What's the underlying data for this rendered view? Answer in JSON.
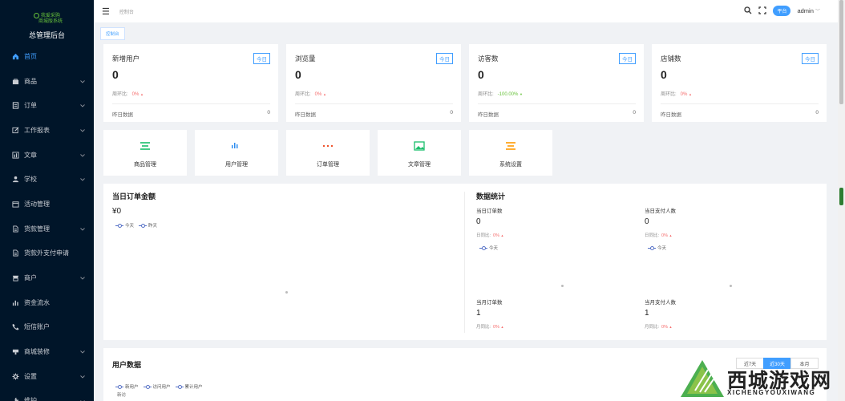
{
  "app": {
    "logo_line1": "我爱采购",
    "logo_line2": "商城版系统",
    "title": "总管理后台"
  },
  "sidebar": {
    "items": [
      {
        "label": "首页",
        "icon": "home-icon",
        "active": true,
        "arrow": false
      },
      {
        "label": "商品",
        "icon": "bag-icon",
        "arrow": true
      },
      {
        "label": "订单",
        "icon": "order-icon",
        "arrow": true
      },
      {
        "label": "工作报表",
        "icon": "edit-icon",
        "arrow": true
      },
      {
        "label": "文章",
        "icon": "chart-icon",
        "arrow": true
      },
      {
        "label": "学校",
        "icon": "user-icon",
        "arrow": true
      },
      {
        "label": "活动管理",
        "icon": "calendar-icon",
        "arrow": false
      },
      {
        "label": "货款管理",
        "icon": "document-icon",
        "arrow": true
      },
      {
        "label": "货款外支付申请",
        "icon": "document-icon",
        "arrow": false
      },
      {
        "label": "商户",
        "icon": "shop-icon",
        "arrow": true
      },
      {
        "label": "资金流水",
        "icon": "bar-chart-icon",
        "arrow": false
      },
      {
        "label": "短信账户",
        "icon": "phone-icon",
        "arrow": false
      },
      {
        "label": "商城装修",
        "icon": "decor-icon",
        "arrow": true
      },
      {
        "label": "设置",
        "icon": "gear-icon",
        "arrow": true
      },
      {
        "label": "维护",
        "icon": "tools-icon",
        "arrow": true
      }
    ]
  },
  "header": {
    "breadcrumb": "控制台",
    "platform_label": "平台",
    "user": "admin"
  },
  "tags": {
    "active": "控制台"
  },
  "stats": [
    {
      "title": "新增用户",
      "badge": "今日",
      "value": "0",
      "compare_label": "周环比:",
      "percent": "0%",
      "trend": "up",
      "yesterday_label": "昨日数据",
      "yesterday_value": "0"
    },
    {
      "title": "浏览量",
      "badge": "今日",
      "value": "0",
      "compare_label": "周环比:",
      "percent": "0%",
      "trend": "up",
      "yesterday_label": "昨日数据",
      "yesterday_value": "0"
    },
    {
      "title": "访客数",
      "badge": "今日",
      "value": "0",
      "compare_label": "周环比:",
      "percent": "-100.00%",
      "trend": "down",
      "yesterday_label": "昨日数据",
      "yesterday_value": "0"
    },
    {
      "title": "店铺数",
      "badge": "今日",
      "value": "0",
      "compare_label": "周环比:",
      "percent": "0%",
      "trend": "up",
      "yesterday_label": "昨日数据",
      "yesterday_value": "0"
    }
  ],
  "quick": [
    {
      "label": "商品管理",
      "icon": "list-icon",
      "color": "#19be6b"
    },
    {
      "label": "用户管理",
      "icon": "bar-chart-icon",
      "color": "#2d8cf0"
    },
    {
      "label": "订单管理",
      "icon": "dots-icon",
      "color": "#ed4014"
    },
    {
      "label": "文章管理",
      "icon": "image-icon",
      "color": "#19be6b"
    },
    {
      "label": "系统设置",
      "icon": "list-icon",
      "color": "#ff9900"
    }
  ],
  "order_amount": {
    "title": "当日订单金额",
    "value": "¥0",
    "legend": [
      "今天",
      "昨天"
    ]
  },
  "data_stats": {
    "title": "数据统计",
    "cells": [
      {
        "label": "当日订单数",
        "value": "0",
        "compare_label": "日同比:",
        "percent": "0%",
        "legend": "今天"
      },
      {
        "label": "当日支付人数",
        "value": "0",
        "compare_label": "日同比:",
        "percent": "0%",
        "legend": "今天"
      },
      {
        "label": "当月订单数",
        "value": "1",
        "compare_label": "月同比:",
        "percent": "0%"
      },
      {
        "label": "当月支付人数",
        "value": "1",
        "compare_label": "月同比:",
        "percent": "0%"
      }
    ]
  },
  "user_data": {
    "title": "用户数据",
    "legend": [
      "新用户",
      "访问用户",
      "累计用户"
    ],
    "y_label": "新访",
    "ranges": [
      "近7天",
      "近30天",
      "本月"
    ],
    "active_range": "近30天"
  },
  "watermark": {
    "text": "西城游戏网",
    "sub": "XICHENGYOUXIWANG"
  },
  "colors": {
    "sidebar_bg": "#001529",
    "accent": "#409eff",
    "up": "#f56c6c",
    "down": "#67c23a"
  }
}
